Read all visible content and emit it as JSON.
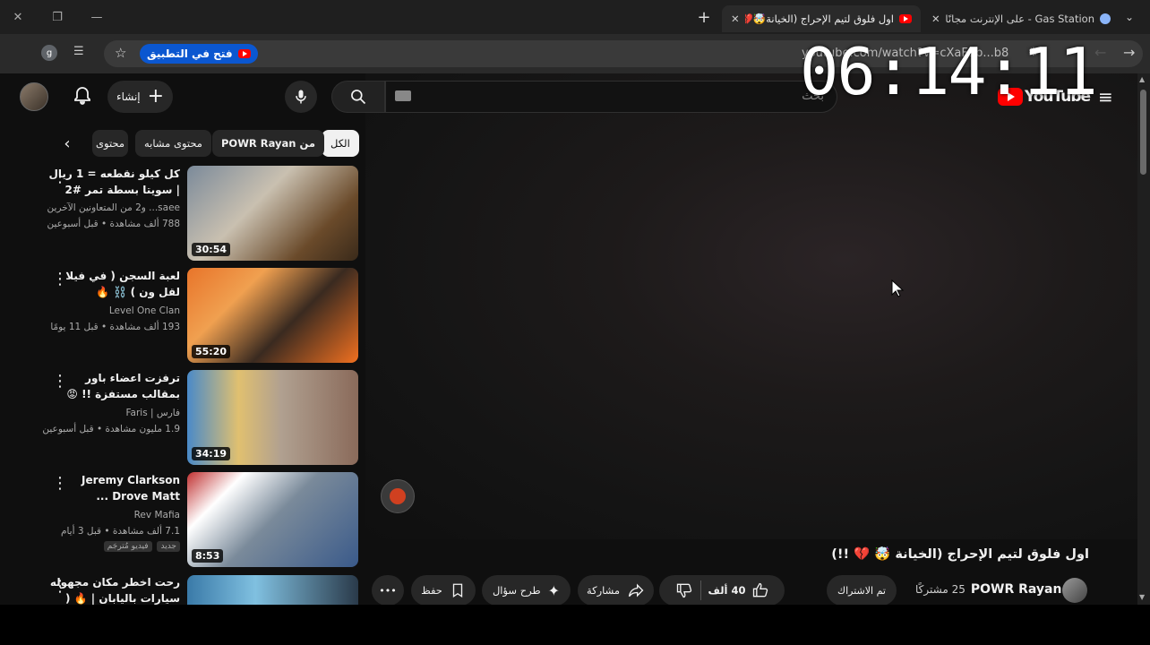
{
  "browser": {
    "tabs": [
      {
        "title": "Gas Station - على الإنترنت مجانًا",
        "active": false
      },
      {
        "title": "اول فلوق لتيم الإحراج (الخيانة🤯💔",
        "active": true
      }
    ],
    "new_tab": "+",
    "window": {
      "minimize": "—",
      "restore": "❐",
      "close": "✕"
    },
    "open_in_app": "فتح في التطبيق",
    "url": "youtube.com/watch?v=cXaF1b...b8",
    "profile_initial": "g",
    "overlay_clock": "06:14:11"
  },
  "youtube": {
    "logo": "YouTube",
    "create_label": "إنشاء",
    "search_placeholder": "بحث",
    "chips": [
      {
        "label": "الكل",
        "selected": true
      },
      {
        "label": "من POWR Rayan",
        "selected": false
      },
      {
        "label": "محتوى مشابه",
        "selected": false
      },
      {
        "label": "محتوى",
        "selected": false
      }
    ],
    "videos": [
      {
        "title": "كل كيلو نقطعه = 1 ريال | سويتا بسطة تمر #2",
        "channel": "saee... و2 من المتعاونين الآخرين",
        "stats": "788 ألف مشاهدة • قبل أسبوعين",
        "duration": "30:54"
      },
      {
        "title": "لعبة السجن ( في فيلا لقل ون ) ⛓️ 🔥",
        "channel": "Level One Clan",
        "stats": "193 ألف مشاهدة • قبل 11 يومًا",
        "duration": "55:20"
      },
      {
        "title": "ترفزت اعضاء باور بمقالب مستفزة !! 😡",
        "channel": "فارس | Faris",
        "stats": "1.9 مليون مشاهدة • قبل أسبوعين",
        "duration": "34:19"
      },
      {
        "title": "Jeremy Clarkson Drove Matt ...",
        "channel": "Rev Mafia",
        "stats": "7.1 ألف مشاهدة • قبل 3 أيام",
        "badges": [
          "جديد",
          "فيديو مُترجَم"
        ],
        "duration": "8:53"
      },
      {
        "title": "رحت اخطر مكان مجهوله سيارات باليابان | 🔥 ( طرك...",
        "channel": "",
        "stats": "",
        "duration": ""
      }
    ],
    "main_title": "اول فلوق لتيم الإحراج (الخيانة 🤯 💔 !!)",
    "channel_name": "POWR Rayan",
    "subscribers": "25 مشتركًا",
    "subscribed_label": "تم الاشتراك",
    "like_count": "40 ألف",
    "share_label": "مشاركة",
    "ask_label": "طرح سؤال",
    "save_label": "حفظ",
    "more_label": "•••",
    "colors": {
      "brand_red": "#ff0000",
      "open_app_blue": "#0b57d0",
      "bg": "#0f0f0f"
    }
  }
}
